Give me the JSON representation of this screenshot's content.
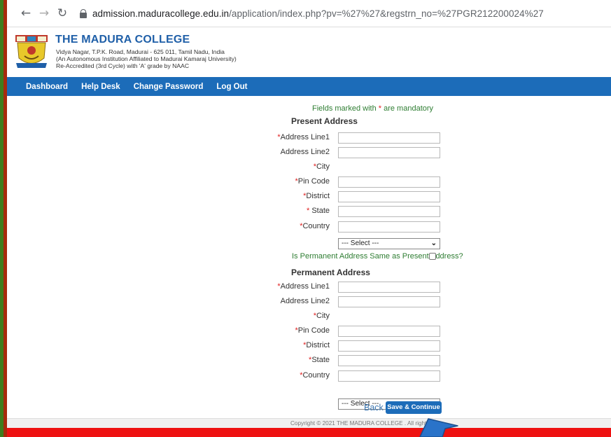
{
  "browser": {
    "back_icon": "←",
    "forward_icon": "→",
    "reload_icon": "↻",
    "url_host": "admission.maduracollege.edu.in",
    "url_path": "/application/index.php?pv=%27%27&regstrn_no=%27PGR212200024%27"
  },
  "header": {
    "college_name": "THE MADURA COLLEGE",
    "address_line": "Vidya Nagar, T.P.K. Road, Madurai - 625 011, Tamil Nadu, India",
    "affiliation_line": "(An Autonomous Institution Affiliated to Madurai Kamaraj University)",
    "accreditation_line": "Re-Accredited (3rd Cycle) with 'A' grade by NAAC"
  },
  "menu": [
    "Dashboard",
    "Help Desk",
    "Change Password",
    "Log Out"
  ],
  "form": {
    "mandatory_note_pre": "Fields marked with ",
    "mandatory_note_star": "*",
    "mandatory_note_post": " are mandatory",
    "present": {
      "heading": "Present Address",
      "fields": [
        {
          "star": "*",
          "label": "Address Line1",
          "value": ""
        },
        {
          "star": "",
          "label": "Address Line2",
          "value": ""
        },
        {
          "star": "*",
          "label": "City",
          "value": "--- Select ---"
        },
        {
          "star": "*",
          "label": "Pin Code",
          "value": ""
        },
        {
          "star": "*",
          "label": "District",
          "value": ""
        },
        {
          "star": "* ",
          "label": "State",
          "value": ""
        },
        {
          "star": "*",
          "label": "Country",
          "value": ""
        }
      ]
    },
    "same_question": "Is Permanent Address Same as Present Address?",
    "same_checked": false,
    "permanent": {
      "heading": "Permanent Address",
      "fields": [
        {
          "star": "*",
          "label": "Address Line1",
          "value": ""
        },
        {
          "star": "",
          "label": "Address Line2",
          "value": ""
        },
        {
          "star": "*",
          "label": "City",
          "value": "--- Select ---"
        },
        {
          "star": "*",
          "label": "Pin Code",
          "value": ""
        },
        {
          "star": "*",
          "label": "District",
          "value": ""
        },
        {
          "star": "*",
          "label": "State",
          "value": ""
        },
        {
          "star": "*",
          "label": "Country",
          "value": ""
        }
      ]
    },
    "back_label": "Back",
    "save_label": "Save & Continue"
  },
  "footer": {
    "copyright": "Copyright © 2021 THE MADURA COLLEGE . All rights res"
  },
  "colors": {
    "frame": "#ee1111",
    "menu_bar": "#1c6cb9",
    "title": "#1f5fa8",
    "note_green": "#2e7d32",
    "required_star": "#e02020"
  },
  "icons": [
    "back-arrow-icon",
    "forward-arrow-icon",
    "reload-icon",
    "lock-icon",
    "chevron-down-icon",
    "college-logo",
    "pointer-arrow-icon"
  ]
}
